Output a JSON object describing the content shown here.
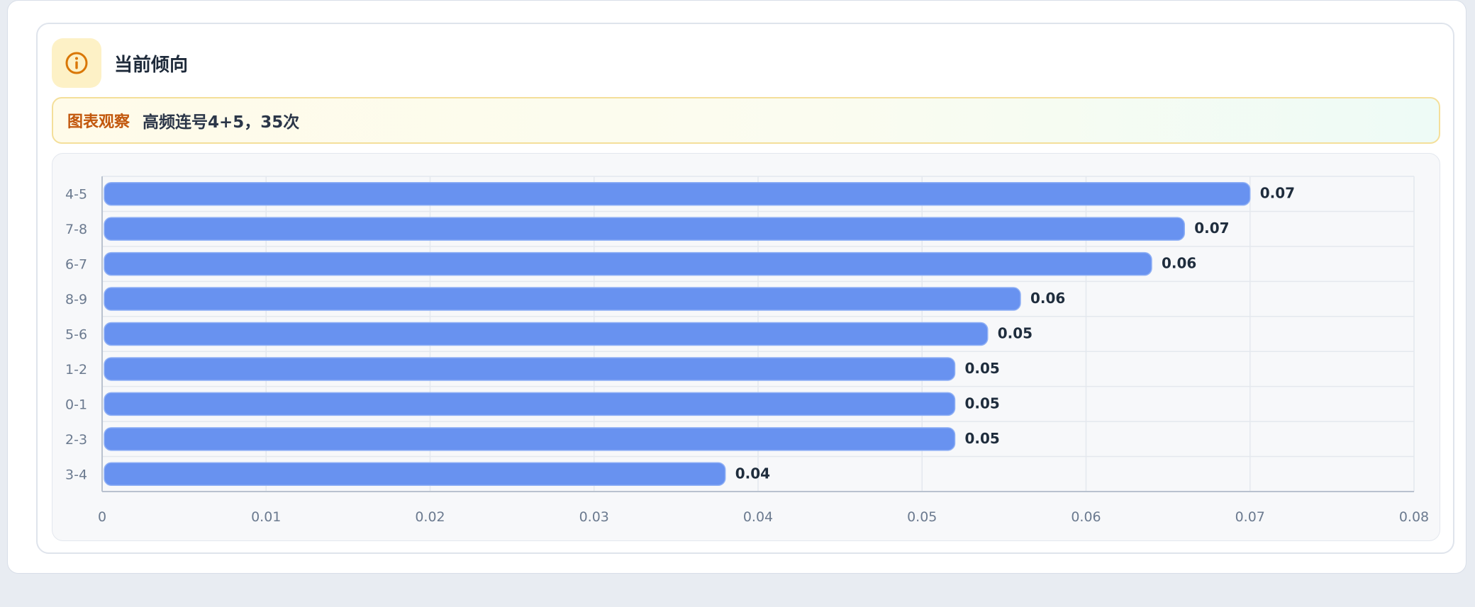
{
  "header": {
    "title": "当前倾向",
    "icon": "info-circle-icon"
  },
  "observation": {
    "label": "图表观察",
    "text": "高频连号4+5，35次"
  },
  "colors": {
    "bar": "#6892f0",
    "bar_stroke": "#8fb0f5",
    "label": "#1f2d3d",
    "tick": "#6b7a8f",
    "grid": "#e4e8ee",
    "axis": "#b9c2cf"
  },
  "chart_data": {
    "type": "bar",
    "orientation": "horizontal",
    "categories": [
      "4-5",
      "7-8",
      "6-7",
      "8-9",
      "5-6",
      "1-2",
      "0-1",
      "2-3",
      "3-4"
    ],
    "values": [
      0.07,
      0.066,
      0.064,
      0.056,
      0.054,
      0.052,
      0.052,
      0.052,
      0.038
    ],
    "value_labels": [
      "0.07",
      "0.07",
      "0.06",
      "0.06",
      "0.05",
      "0.05",
      "0.05",
      "0.05",
      "0.04"
    ],
    "xlim": [
      0,
      0.08
    ],
    "xticks": [
      "0",
      "0.01",
      "0.02",
      "0.03",
      "0.04",
      "0.05",
      "0.06",
      "0.07",
      "0.08"
    ],
    "grid": true
  }
}
